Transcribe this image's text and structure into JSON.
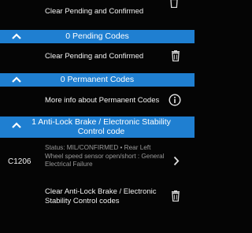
{
  "rows": {
    "clear_top": {
      "label": "Clear Pending and Confirmed",
      "icon": "trash-icon"
    },
    "pending_header": {
      "title": "0 Pending Codes",
      "icon": "chevron-up-icon"
    },
    "clear_pending": {
      "label": "Clear Pending and Confirmed",
      "icon": "trash-icon"
    },
    "permanent_header": {
      "title": "0 Permanent Codes",
      "icon": "chevron-up-icon"
    },
    "permanent_info": {
      "label": "More info about Permanent Codes",
      "icon": "info-icon"
    },
    "abs_header": {
      "title": "1 Anti-Lock Brake / Electronic Stability Control code",
      "icon": "chevron-up-icon"
    },
    "abs_code": {
      "code": "C1206",
      "description": "Status: MIL/CONFIRMED • Rear Left Wheel speed sensor open/short : General Electrical Failure",
      "icon": "chevron-right-icon"
    },
    "clear_abs": {
      "label": "Clear Anti-Lock Brake / Electronic Stability Control codes",
      "icon": "trash-icon"
    }
  },
  "colors": {
    "background": "#050505",
    "header": "#1f7fd1",
    "text": "#f2f2f2",
    "muted_text": "#9a9a9a"
  }
}
